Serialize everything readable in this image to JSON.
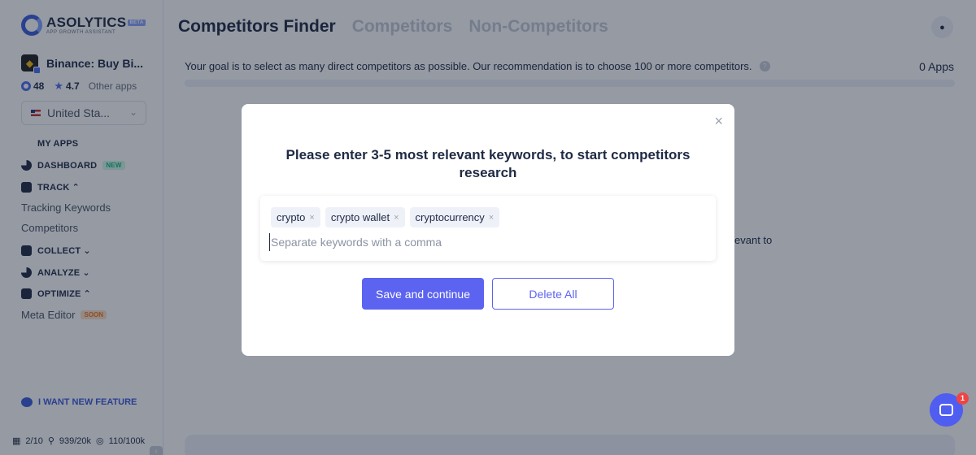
{
  "brand": {
    "name": "ASOLYTICS",
    "badge": "BETA",
    "tagline": "APP GROWTH ASSISTANT"
  },
  "app": {
    "name": "Binance: Buy Bi...",
    "score": "48",
    "rating": "4.7",
    "other_apps_label": "Other apps",
    "icon": "binance-icon"
  },
  "country": {
    "selected": "United Sta..."
  },
  "sidebar": {
    "my_apps": "MY APPS",
    "dashboard": "DASHBOARD",
    "dashboard_badge": "NEW",
    "track": "TRACK",
    "track_items": [
      "Tracking Keywords",
      "Competitors"
    ],
    "collect": "COLLECT",
    "analyze": "ANALYZE",
    "optimize": "OPTIMIZE",
    "optimize_item": "Meta Editor",
    "optimize_badge": "SOON",
    "feature_request": "I WANT NEW FEATURE",
    "quota_apps": "2/10",
    "quota_keywords": "939/20k",
    "quota_other": "110/100k"
  },
  "header": {
    "title": "Competitors Finder",
    "tabs": [
      "Competitors",
      "Non-Competitors"
    ]
  },
  "goal": {
    "text": "Your goal is to select as many direct competitors as possible. Our recommendation is to choose 100 or more competitors.",
    "help_icon": "?",
    "count_label": "0 Apps",
    "progress": 0
  },
  "background_text": "evant to",
  "modal": {
    "title": "Please enter 3-5 most relevant keywords, to start competitors research",
    "keywords": [
      "crypto",
      "crypto wallet",
      "cryptocurrency"
    ],
    "input_placeholder": "Separate keywords with a comma",
    "save_label": "Save and continue",
    "delete_label": "Delete All",
    "close_symbol": "×",
    "chip_remove_symbol": "×"
  },
  "chat": {
    "unread": "1"
  },
  "colors": {
    "accent": "#5b63f0",
    "brand": "#3b5bdb",
    "text": "#1f2a44"
  }
}
